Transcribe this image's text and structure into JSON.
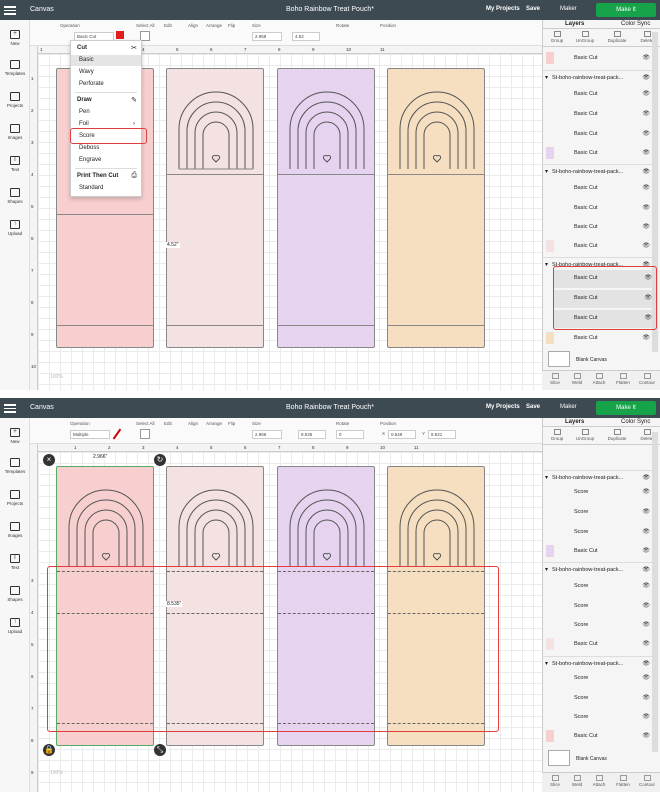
{
  "header": {
    "app": "Canvas",
    "my_projects": "My Projects",
    "save": "Save",
    "machine": "Maker",
    "make_it": "Make It"
  },
  "nav": [
    "New",
    "Templates",
    "Projects",
    "Images",
    "Text",
    "Shapes",
    "Upload"
  ],
  "top": {
    "project_title": "Boho Rainbow Treat Pouch*",
    "operation_label": "Operation",
    "operation_value": "Basic Cut",
    "toolbar_labels": [
      "Select All",
      "Edit",
      "Align",
      "Arrange",
      "Flip",
      "Size",
      "Rotate",
      "Position"
    ],
    "size_w": "2.959",
    "size_h": "4.52",
    "ruler_marks": [
      "1",
      "2",
      "3",
      "4",
      "5",
      "6",
      "7",
      "8",
      "9",
      "10",
      "11"
    ],
    "ruler_left": [
      "1",
      "2",
      "3",
      "4",
      "5",
      "6",
      "7",
      "8",
      "9",
      "10"
    ],
    "dim_label": "4.52\"",
    "zoom": "100%",
    "dropdown": {
      "cut": "Cut",
      "basic": "Basic",
      "wavy": "Wavy",
      "perforate": "Perforate",
      "draw": "Draw",
      "pen": "Pen",
      "foil": "Foil",
      "score": "Score",
      "deboss": "Deboss",
      "engrave": "Engrave",
      "print_then_cut": "Print Then Cut",
      "standard": "Standard"
    },
    "panel_tabs": [
      "Layers",
      "Color Sync"
    ],
    "panel_actions": [
      "Group",
      "UnGroup",
      "Duplicate",
      "Delete"
    ],
    "group_name": "St-boho-rainbow-treat-pack...",
    "layer_label": "Basic Cut",
    "blank_canvas": "Blank Canvas",
    "bottom_actions": [
      "Slice",
      "Weld",
      "Attach",
      "Flatten",
      "Contour"
    ]
  },
  "bottom": {
    "project_title": "Boho Rainbow Treat Pouch*",
    "operation_label": "Operation",
    "operation_value": "Multiple",
    "toolbar_labels": [
      "Select All",
      "Edit",
      "Align",
      "Arrange",
      "Flip",
      "Size",
      "Rotate",
      "Position"
    ],
    "size_w": "2.966",
    "size_h": "8.535",
    "rotate": "0",
    "pos_x": "0.549",
    "pos_y": "8.521",
    "pos_x_label": "X",
    "pos_y_label": "Y",
    "ruler_marks": [
      "1",
      "2",
      "3",
      "4",
      "5",
      "6",
      "7",
      "8",
      "9",
      "10",
      "11"
    ],
    "ruler_left": [
      "3",
      "4",
      "5",
      "6",
      "7",
      "8",
      "9",
      "10"
    ],
    "dim_top": "2.966\"",
    "dim_side": "8.535\"",
    "zoom": "100%",
    "panel_tabs": [
      "Layers",
      "Color Sync"
    ],
    "panel_actions": [
      "Group",
      "UnGroup",
      "Duplicate",
      "Delete"
    ],
    "group_name": "St-boho-rainbow-treat-pack...",
    "score_label": "Score",
    "layer_label": "Basic Cut",
    "blank_canvas": "Blank Canvas",
    "bottom_actions": [
      "Slice",
      "Weld",
      "Attach",
      "Flatten",
      "Contour"
    ]
  },
  "colors": {
    "pink": "#f8cfcf",
    "blush": "#f4e1e1",
    "lavender": "#e6d3ef",
    "peach": "#f5dfc0",
    "accent": "#16a34a",
    "highlight": "#e23d3d"
  }
}
